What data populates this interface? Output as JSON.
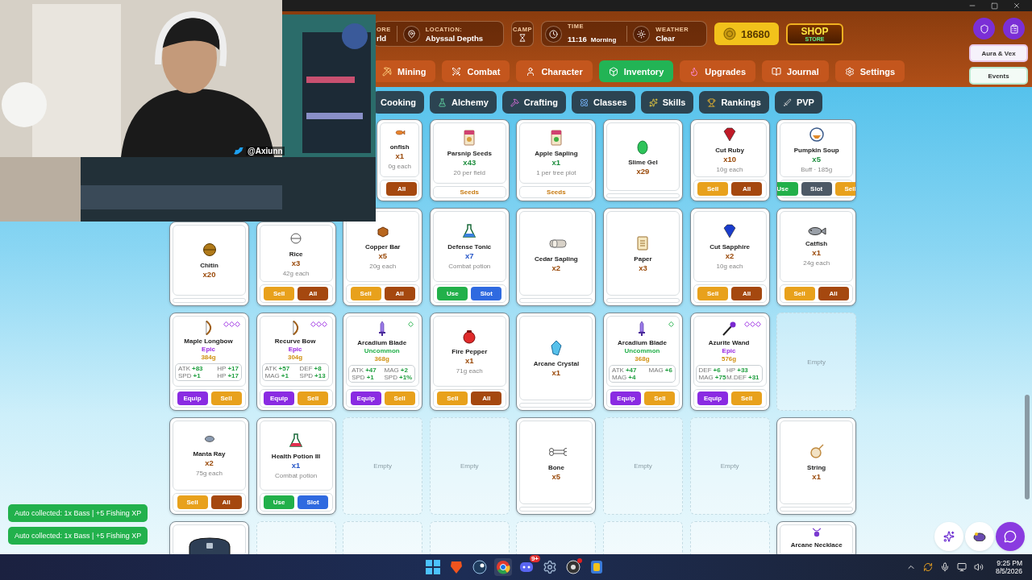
{
  "header": {
    "stats": [
      {
        "label": "ORE",
        "value": "rld"
      },
      {
        "label": "LOCATION:",
        "value": "Abyssal Depths"
      }
    ],
    "camp": {
      "label": "CAMP"
    },
    "time": {
      "label": "TIME",
      "value": "11:16",
      "period": "Morning"
    },
    "weather": {
      "label": "WEATHER",
      "value": "Clear"
    },
    "gold": "18680",
    "shop": {
      "title": "SHOP",
      "subtitle": "STORE"
    }
  },
  "side_buttons": [
    "Aura & Vex",
    "Events"
  ],
  "tabs": [
    {
      "label": "Mining",
      "selected": false
    },
    {
      "label": "Combat",
      "selected": false
    },
    {
      "label": "Character",
      "selected": false
    },
    {
      "label": "Inventory",
      "selected": true
    },
    {
      "label": "Upgrades",
      "selected": false
    },
    {
      "label": "Journal",
      "selected": false
    },
    {
      "label": "Settings",
      "selected": false
    }
  ],
  "subtabs": [
    {
      "label": "Cooking"
    },
    {
      "label": "Alchemy"
    },
    {
      "label": "Crafting"
    },
    {
      "label": "Classes"
    },
    {
      "label": "Skills"
    },
    {
      "label": "Rankings"
    },
    {
      "label": "PVP"
    }
  ],
  "stream_overlay": {
    "handle": "@Axiunn"
  },
  "grid": {
    "rows": [
      [
        "",
        "",
        {
          "kind": "partial",
          "name": "onfish",
          "qty": "x1",
          "color": "#9a4a0a",
          "note": "0g each",
          "footer": {
            "kind": "buttons",
            "buttons": [
              {
                "label": "All",
                "kind": "all"
              }
            ]
          }
        },
        {
          "kind": "item",
          "name": "Parsnip Seeds",
          "qty": "x43",
          "color": "#1e8e3e",
          "note": "20 per field",
          "footer": {
            "kind": "label",
            "label": "Seeds"
          }
        },
        {
          "kind": "item",
          "name": "Apple Sapling",
          "qty": "x1",
          "color": "#1e8e3e",
          "note": "1 per tree plot",
          "footer": {
            "kind": "label",
            "label": "Seeds"
          }
        },
        {
          "kind": "item",
          "name": "Slime Gel",
          "qty": "x29",
          "color": "#9a4a0a",
          "footer": {
            "kind": "blank"
          }
        },
        {
          "kind": "item",
          "name": "Cut Ruby",
          "qty": "x10",
          "color": "#9a4a0a",
          "note": "10g each",
          "footer": {
            "kind": "buttons",
            "buttons": [
              {
                "label": "Sell",
                "kind": "sell"
              },
              {
                "label": "All",
                "kind": "all"
              }
            ]
          }
        },
        {
          "kind": "item",
          "name": "Pumpkin Soup",
          "qty": "x5",
          "color": "#1e8e3e",
          "note": "Buff · 185g",
          "footer": {
            "kind": "buttons",
            "buttons": [
              {
                "label": "Use",
                "kind": "use"
              },
              {
                "label": "Slot",
                "kind": "muted"
              },
              {
                "label": "Sell",
                "kind": "sell"
              }
            ]
          }
        }
      ],
      [
        {
          "kind": "item",
          "name": "Chitin",
          "qty": "x20",
          "color": "#9a4a0a",
          "footer": {
            "kind": "blank"
          }
        },
        {
          "kind": "item",
          "name": "Rice",
          "qty": "x3",
          "color": "#9a4a0a",
          "note": "42g each",
          "footer": {
            "kind": "buttons",
            "buttons": [
              {
                "label": "Sell",
                "kind": "sell"
              },
              {
                "label": "All",
                "kind": "all"
              }
            ]
          }
        },
        {
          "kind": "item",
          "name": "Copper Bar",
          "qty": "x5",
          "color": "#9a4a0a",
          "note": "20g each",
          "footer": {
            "kind": "buttons",
            "buttons": [
              {
                "label": "Sell",
                "kind": "sell"
              },
              {
                "label": "All",
                "kind": "all"
              }
            ]
          }
        },
        {
          "kind": "item",
          "name": "Defense Tonic",
          "qty": "x7",
          "color": "#2656c8",
          "note": "Combat potion",
          "footer": {
            "kind": "buttons",
            "buttons": [
              {
                "label": "Use",
                "kind": "use"
              },
              {
                "label": "Slot",
                "kind": "slot"
              }
            ]
          }
        },
        {
          "kind": "item",
          "name": "Cedar Sapling",
          "qty": "x2",
          "color": "#9a4a0a",
          "footer": {
            "kind": "blank"
          }
        },
        {
          "kind": "item",
          "name": "Paper",
          "qty": "x3",
          "color": "#9a4a0a",
          "footer": {
            "kind": "blank"
          }
        },
        {
          "kind": "item",
          "name": "Cut Sapphire",
          "qty": "x2",
          "color": "#9a4a0a",
          "note": "10g each",
          "footer": {
            "kind": "buttons",
            "buttons": [
              {
                "label": "Sell",
                "kind": "sell"
              },
              {
                "label": "All",
                "kind": "all"
              }
            ]
          }
        },
        {
          "kind": "item",
          "name": "Catfish",
          "qty": "x1",
          "color": "#9a4a0a",
          "note": "24g each",
          "footer": {
            "kind": "buttons",
            "buttons": [
              {
                "label": "Sell",
                "kind": "sell"
              },
              {
                "label": "All",
                "kind": "all"
              }
            ]
          }
        }
      ],
      [
        {
          "kind": "epic",
          "name": "Maple Longbow",
          "rarity": "Epic",
          "price": "384g",
          "stats": [
            {
              "stat": "ATK",
              "value": "+83"
            },
            {
              "stat": "HP",
              "value": "+17"
            },
            {
              "stat": "SPD",
              "value": "+1"
            },
            {
              "stat": "HP",
              "value": "+17"
            }
          ],
          "buttons": [
            {
              "label": "Equip",
              "kind": "equip"
            },
            {
              "label": "Sell",
              "kind": "sell"
            }
          ]
        },
        {
          "kind": "epic",
          "name": "Recurve Bow",
          "rarity": "Epic",
          "price": "304g",
          "stats": [
            {
              "stat": "ATK",
              "value": "+57"
            },
            {
              "stat": "DEF",
              "value": "+8"
            },
            {
              "stat": "MAG",
              "value": "+1"
            },
            {
              "stat": "SPD",
              "value": "+13"
            }
          ],
          "buttons": [
            {
              "label": "Equip",
              "kind": "equip"
            },
            {
              "label": "Sell",
              "kind": "sell"
            }
          ]
        },
        {
          "kind": "uncommon",
          "name": "Arcadium Blade",
          "rarity": "Uncommon",
          "price": "368g",
          "stats": [
            {
              "stat": "ATK",
              "value": "+47"
            },
            {
              "stat": "MAG",
              "value": "+2"
            },
            {
              "stat": "SPD",
              "value": "+1"
            },
            {
              "stat": "SPD",
              "value": "+1%"
            }
          ],
          "buttons": [
            {
              "label": "Equip",
              "kind": "equip"
            },
            {
              "label": "Sell",
              "kind": "sell"
            }
          ]
        },
        {
          "kind": "item",
          "name": "Fire Pepper",
          "qty": "x1",
          "color": "#9a4a0a",
          "note": "71g each",
          "footer": {
            "kind": "buttons",
            "buttons": [
              {
                "label": "Sell",
                "kind": "sell"
              },
              {
                "label": "All",
                "kind": "all"
              }
            ]
          }
        },
        {
          "kind": "item",
          "name": "Arcane Crystal",
          "qty": "x1",
          "color": "#9a4a0a",
          "footer": {
            "kind": "blank"
          }
        },
        {
          "kind": "uncommon",
          "name": "Arcadium Blade",
          "rarity": "Uncommon",
          "price": "368g",
          "stats": [
            {
              "stat": "ATK",
              "value": "+47"
            },
            {
              "stat": "MAG",
              "value": "+6"
            },
            {
              "stat": "MAG",
              "value": "+4"
            }
          ],
          "buttons": [
            {
              "label": "Equip",
              "kind": "equip"
            },
            {
              "label": "Sell",
              "kind": "sell"
            }
          ]
        },
        {
          "kind": "epic",
          "name": "Azurite Wand",
          "rarity": "Epic",
          "price": "576g",
          "stats": [
            {
              "stat": "DEF",
              "value": "+6"
            },
            {
              "stat": "HP",
              "value": "+33"
            },
            {
              "stat": "MAG",
              "value": "+75"
            },
            {
              "stat": "M.DEF",
              "value": "+31"
            }
          ],
          "buttons": [
            {
              "label": "Equip",
              "kind": "equip"
            },
            {
              "label": "Sell",
              "kind": "sell"
            }
          ]
        },
        {
          "kind": "empty",
          "label": "Empty"
        }
      ],
      [
        {
          "kind": "item",
          "name": "Manta Ray",
          "qty": "x2",
          "color": "#9a4a0a",
          "note": "75g each",
          "footer": {
            "kind": "buttons",
            "buttons": [
              {
                "label": "Sell",
                "kind": "sell"
              },
              {
                "label": "All",
                "kind": "all"
              }
            ]
          }
        },
        {
          "kind": "item",
          "name": "Health Potion III",
          "qty": "x1",
          "color": "#2656c8",
          "note": "Combat potion",
          "footer": {
            "kind": "buttons",
            "buttons": [
              {
                "label": "Use",
                "kind": "use"
              },
              {
                "label": "Slot",
                "kind": "slot"
              }
            ]
          }
        },
        {
          "kind": "empty",
          "label": "Empty"
        },
        {
          "kind": "empty",
          "label": "Empty"
        },
        {
          "kind": "item",
          "name": "Bone",
          "qty": "x5",
          "color": "#9a4a0a",
          "footer": {
            "kind": "blank"
          }
        },
        {
          "kind": "empty",
          "label": "Empty"
        },
        {
          "kind": "empty",
          "label": "Empty"
        },
        {
          "kind": "item",
          "name": "String",
          "qty": "x1",
          "color": "#9a4a0a",
          "footer": {
            "kind": "blank"
          }
        }
      ],
      [
        {
          "kind": "stub"
        },
        {
          "kind": "empty"
        },
        {
          "kind": "empty"
        },
        {
          "kind": "empty"
        },
        {
          "kind": "empty"
        },
        {
          "kind": "empty"
        },
        {
          "kind": "empty"
        },
        {
          "kind": "stub",
          "name": "Arcane Necklace"
        }
      ]
    ]
  },
  "toasts": [
    "Auto collected: 1x Bass | +5 Fishing XP",
    "Auto collected: 1x Bass | +5 Fishing XP"
  ],
  "taskbar": {
    "badge": "9+",
    "time": "9:25 PM",
    "date": "8/5/2026"
  }
}
